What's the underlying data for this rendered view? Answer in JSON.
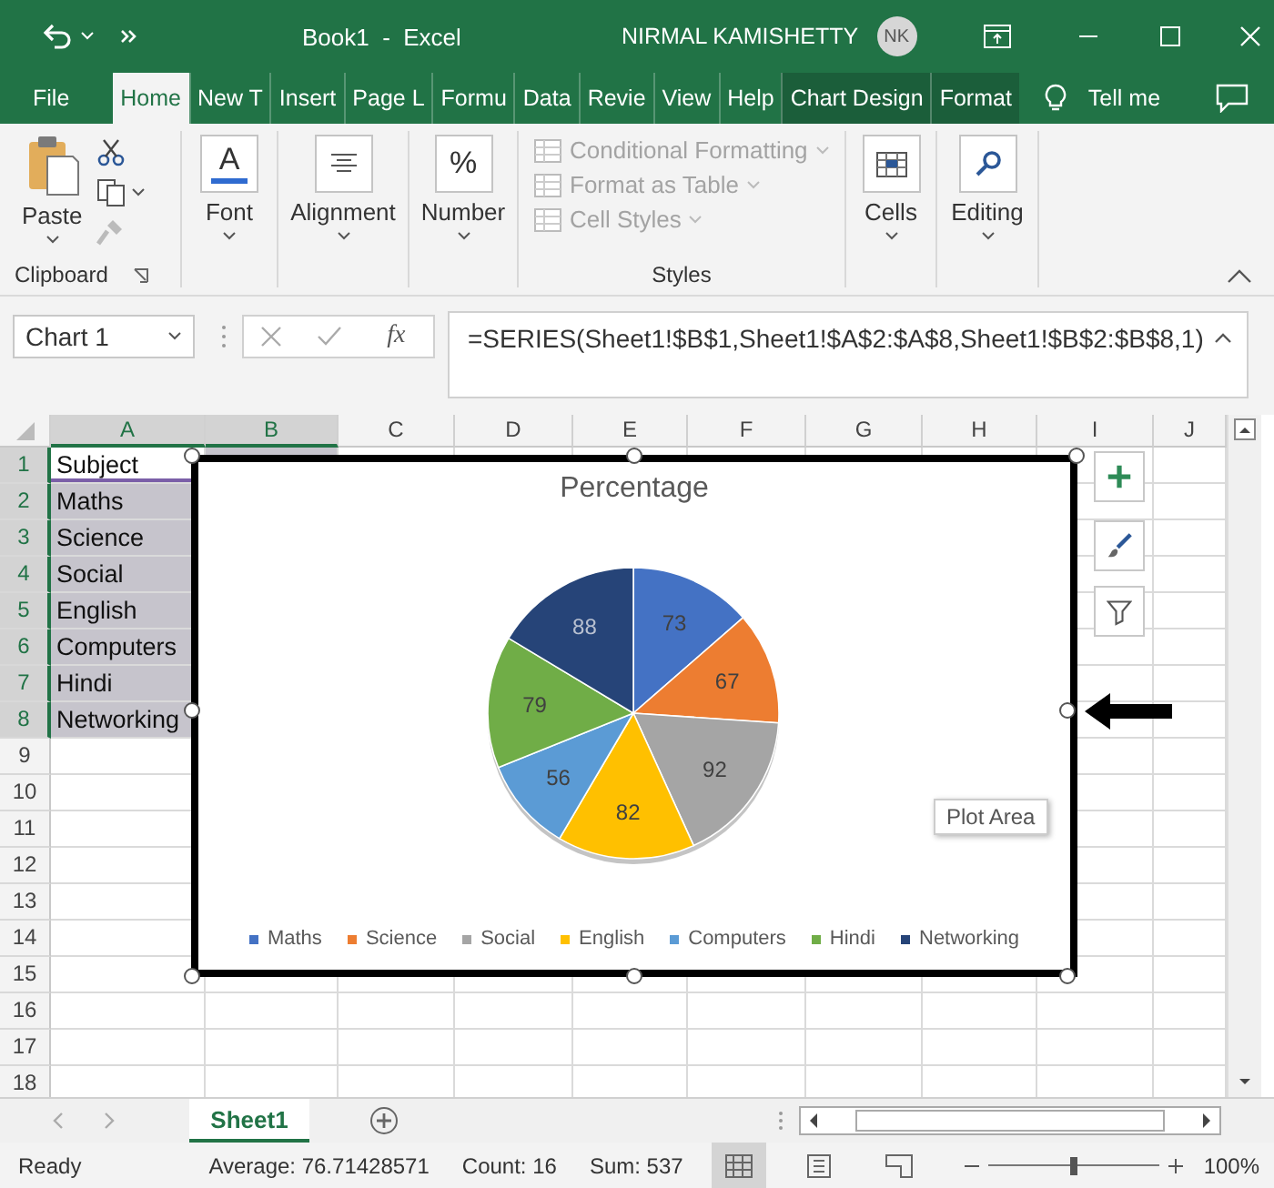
{
  "window": {
    "title": "Book1  -  Excel",
    "user": "NIRMAL KAMISHETTY",
    "avatar": "NK"
  },
  "tabs": [
    {
      "label": "File",
      "selected": false,
      "contextual": false
    },
    {
      "label": "Home",
      "selected": true,
      "contextual": false
    },
    {
      "label": "New T",
      "selected": false,
      "contextual": false
    },
    {
      "label": "Insert",
      "selected": false,
      "contextual": false
    },
    {
      "label": "Page L",
      "selected": false,
      "contextual": false
    },
    {
      "label": "Formu",
      "selected": false,
      "contextual": false
    },
    {
      "label": "Data",
      "selected": false,
      "contextual": false
    },
    {
      "label": "Revie",
      "selected": false,
      "contextual": false
    },
    {
      "label": "View",
      "selected": false,
      "contextual": false
    },
    {
      "label": "Help",
      "selected": false,
      "contextual": false
    },
    {
      "label": "Chart Design",
      "selected": false,
      "contextual": true
    },
    {
      "label": "Format",
      "selected": false,
      "contextual": true
    }
  ],
  "tell_me": "Tell me",
  "ribbon": {
    "groups": [
      {
        "kind": "clipboard",
        "label": "Clipboard",
        "paste": "Paste"
      },
      {
        "kind": "font",
        "button": "Font",
        "glyph": "A"
      },
      {
        "kind": "alignment",
        "button": "Alignment"
      },
      {
        "kind": "number",
        "button": "Number",
        "glyph": "%"
      },
      {
        "kind": "styles",
        "label": "Styles",
        "items": [
          {
            "label": "Conditional Formatting",
            "disabled": true
          },
          {
            "label": "Format as Table",
            "disabled": true
          },
          {
            "label": "Cell Styles",
            "disabled": true
          }
        ]
      },
      {
        "kind": "cells",
        "button": "Cells"
      },
      {
        "kind": "editing",
        "button": "Editing"
      }
    ]
  },
  "formula_bar": {
    "name_box": "Chart 1",
    "function_glyph": "fx",
    "formula": "=SERIES(Sheet1!$B$1,Sheet1!$A$2:$A$8,Sheet1!$B$2:$B$8,1)"
  },
  "sheet": {
    "columns": [
      {
        "label": "A",
        "selected": true
      },
      {
        "label": "B",
        "selected": true
      },
      {
        "label": "C",
        "selected": false
      },
      {
        "label": "D",
        "selected": false
      },
      {
        "label": "E",
        "selected": false
      },
      {
        "label": "F",
        "selected": false
      },
      {
        "label": "G",
        "selected": false
      },
      {
        "label": "H",
        "selected": false
      },
      {
        "label": "I",
        "selected": false
      },
      {
        "label": "J",
        "selected": false
      }
    ],
    "rows": [
      {
        "number": "1",
        "a": "Subject",
        "selected": true,
        "active": true
      },
      {
        "number": "2",
        "a": "Maths",
        "selected": true,
        "active": false
      },
      {
        "number": "3",
        "a": "Science",
        "selected": true,
        "active": false
      },
      {
        "number": "4",
        "a": "Social",
        "selected": true,
        "active": false
      },
      {
        "number": "5",
        "a": "English",
        "selected": true,
        "active": false
      },
      {
        "number": "6",
        "a": "Computers",
        "selected": true,
        "active": false
      },
      {
        "number": "7",
        "a": "Hindi",
        "selected": true,
        "active": false
      },
      {
        "number": "8",
        "a": "Networking",
        "selected": true,
        "active": false
      },
      {
        "number": "9",
        "selected": false,
        "active": false
      },
      {
        "number": "10",
        "selected": false,
        "active": false
      },
      {
        "number": "11",
        "selected": false,
        "active": false
      },
      {
        "number": "12",
        "selected": false,
        "active": false
      },
      {
        "number": "13",
        "selected": false,
        "active": false
      },
      {
        "number": "14",
        "selected": false,
        "active": false
      },
      {
        "number": "15",
        "selected": false,
        "active": false
      },
      {
        "number": "16",
        "selected": false,
        "active": false
      },
      {
        "number": "17",
        "selected": false,
        "active": false
      },
      {
        "number": "18",
        "selected": false,
        "active": false
      }
    ]
  },
  "chart": {
    "chart_data": {
      "type": "pie",
      "title": "Percentage",
      "categories": [
        "Maths",
        "Science",
        "Social",
        "English",
        "Computers",
        "Hindi",
        "Networking"
      ],
      "series": [
        {
          "values": [
            73,
            67,
            92,
            82,
            56,
            79,
            88
          ]
        }
      ],
      "data_labels": true,
      "legend": "bottom"
    },
    "tooltip": "Plot Area"
  },
  "sheet_tabs": [
    {
      "label": "Sheet1",
      "selected": true
    }
  ],
  "status_bar": {
    "mode": "Ready",
    "average": "Average: 76.71428571",
    "count": "Count: 16",
    "sum": "Sum: 537",
    "views": [
      {
        "kind": "normal",
        "selected": true
      },
      {
        "kind": "page-layout",
        "selected": false
      },
      {
        "kind": "page-break",
        "selected": false
      }
    ],
    "zoom": {
      "level": 0.5,
      "reading": "100%"
    }
  }
}
